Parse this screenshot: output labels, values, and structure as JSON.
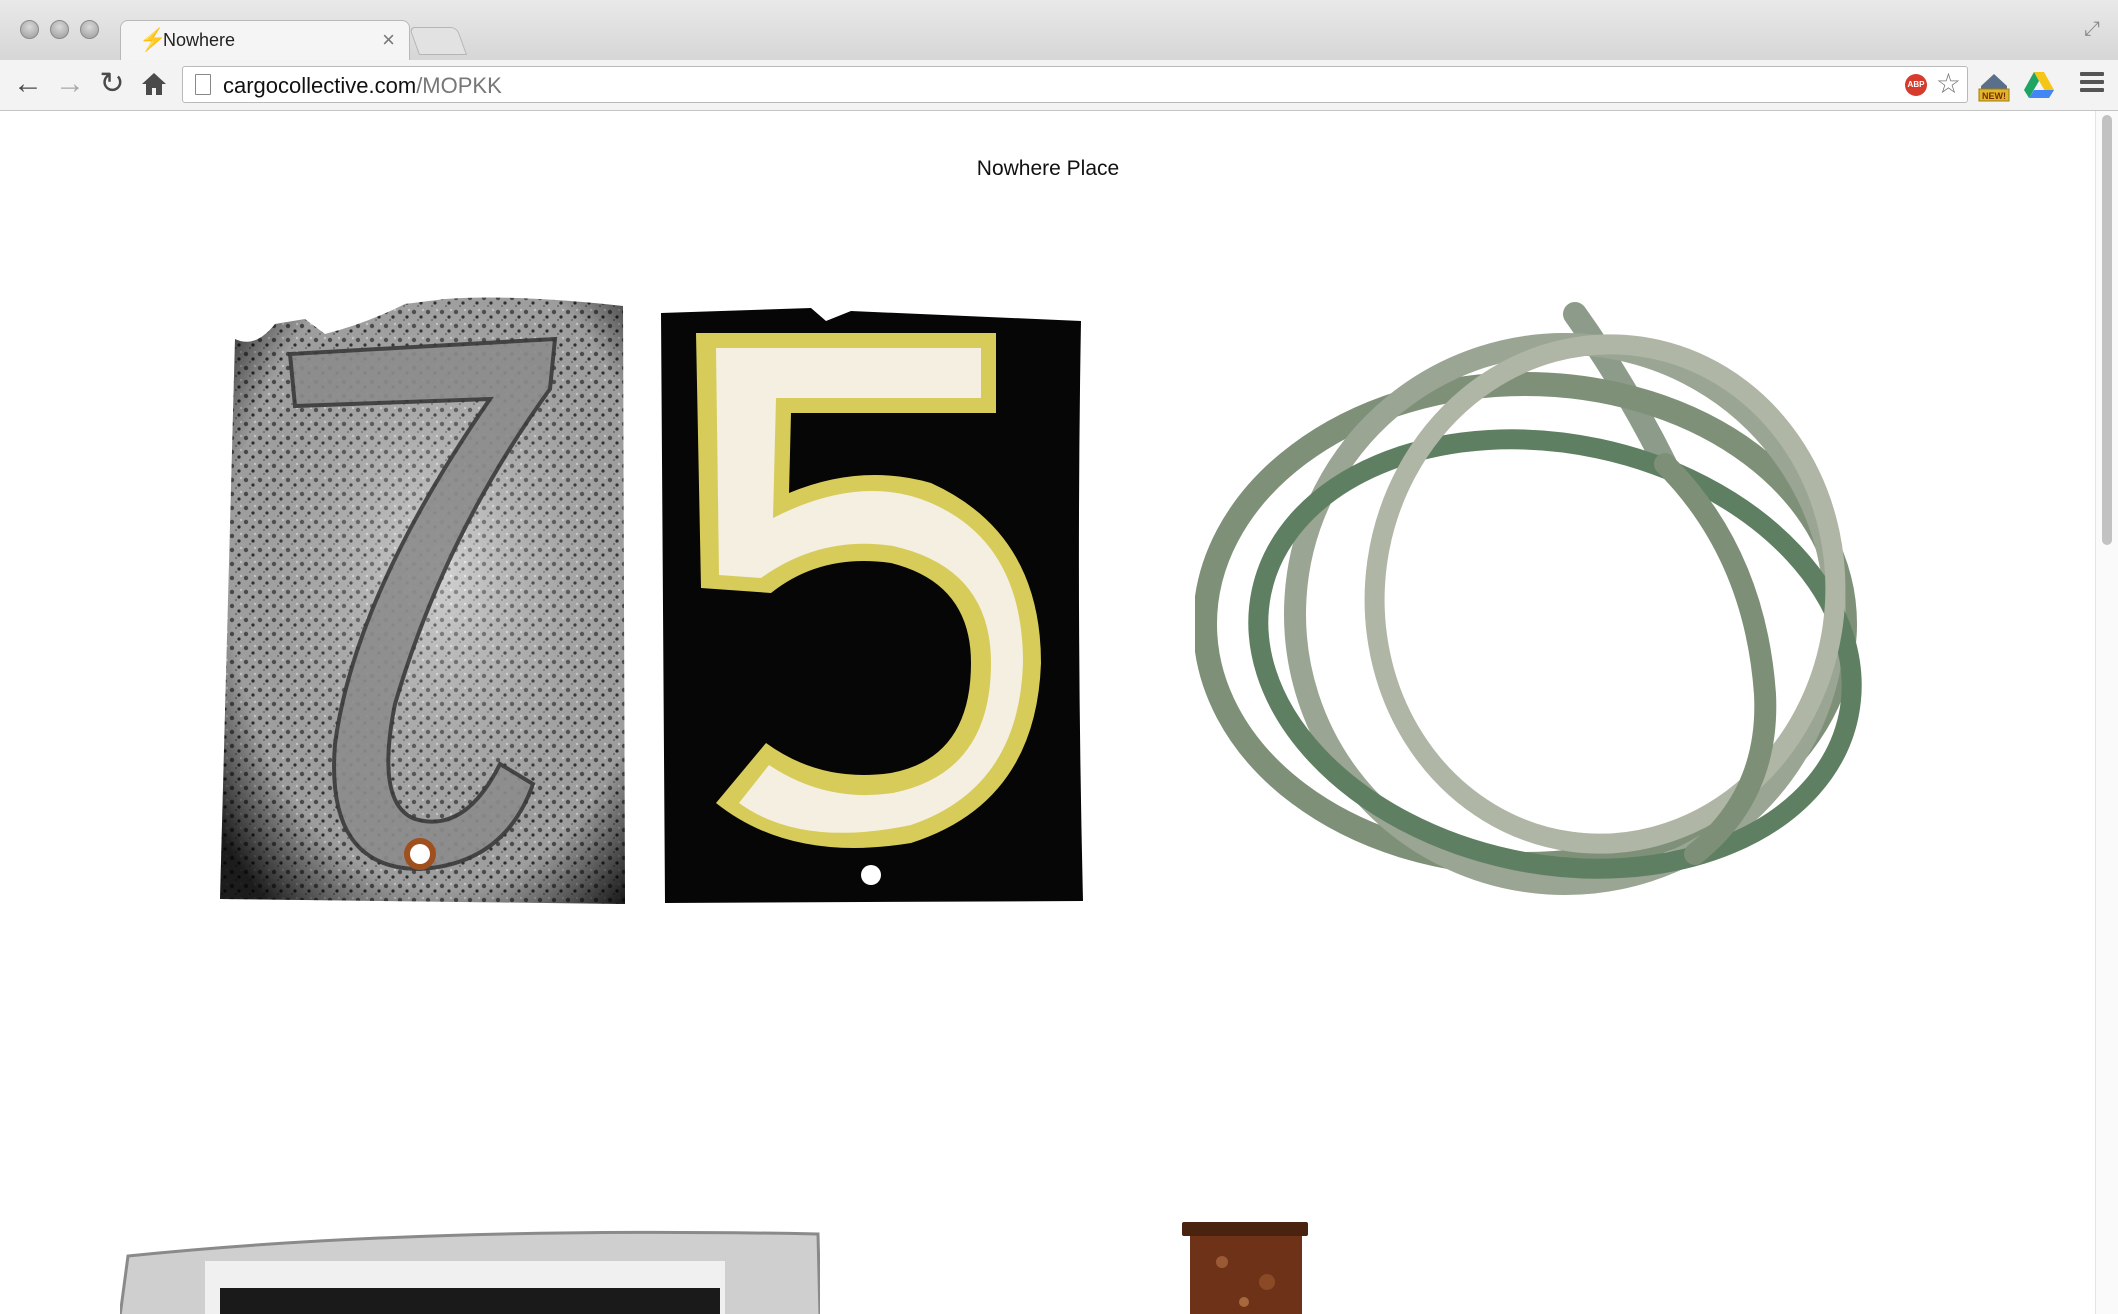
{
  "browser": {
    "tab_title": "Nowhere",
    "tab_close": "×",
    "url_host": "cargocollective.com",
    "url_path": "/MOPKK",
    "extension_badge": "NEW!",
    "adblock_label": "ABP"
  },
  "page": {
    "site_title": "Nowhere Place"
  },
  "images": [
    {
      "subject": "house number 7 on rusted speckled metal plate"
    },
    {
      "subject": "house number 5 in cream with yellow outline on black plate"
    },
    {
      "subject": "coiled green-stained rubber hose"
    },
    {
      "subject": "partial house number plate, bottom left"
    },
    {
      "subject": "rusty metal post, bottom center"
    }
  ],
  "colors": {
    "page_background": "#ffffff",
    "title_text": "#111111",
    "adblock_red": "#d63b2e"
  }
}
